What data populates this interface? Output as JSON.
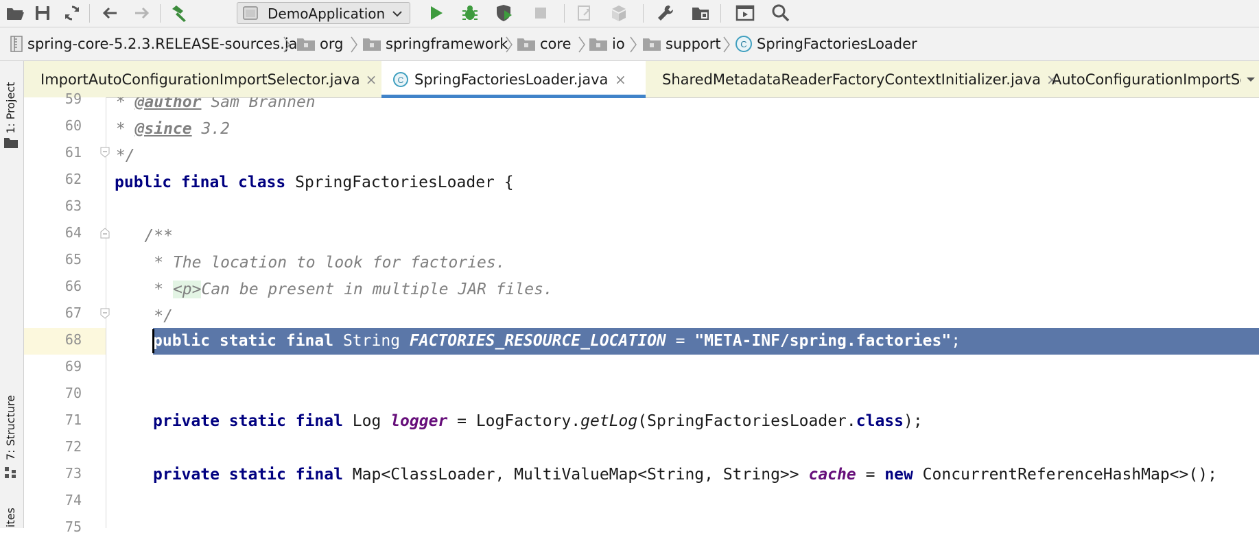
{
  "toolbar": {
    "run_config": "DemoApplication",
    "icons": [
      "open-icon",
      "save-icon",
      "sync-icon",
      "back-icon",
      "forward-icon",
      "build-hammer-icon",
      "run-icon",
      "debug-icon",
      "coverage-icon",
      "stop-icon",
      "update-icon",
      "deploy-icon",
      "settings-wrench-icon",
      "project-structure-icon",
      "run-anything-icon",
      "search-icon"
    ]
  },
  "breadcrumb": {
    "items": [
      {
        "label": "spring-core-5.2.3.RELEASE-sources.jar",
        "icon": "jar-icon"
      },
      {
        "label": "org",
        "icon": "package-folder-icon"
      },
      {
        "label": "springframework",
        "icon": "package-folder-icon"
      },
      {
        "label": "core",
        "icon": "package-folder-icon"
      },
      {
        "label": "io",
        "icon": "package-folder-icon"
      },
      {
        "label": "support",
        "icon": "package-folder-icon"
      },
      {
        "label": "SpringFactoriesLoader",
        "icon": "class-icon"
      }
    ]
  },
  "left_strip": {
    "project_tab": "1: Project",
    "structure_tab": "7: Structure",
    "favorites_tab": "ites"
  },
  "tabs": [
    {
      "label": "ImportAutoConfigurationImportSelector.java",
      "close": "×",
      "active": false
    },
    {
      "label": "SpringFactoriesLoader.java",
      "close": "×",
      "active": true
    },
    {
      "label": "SharedMetadataReaderFactoryContextInitializer.java",
      "close": "×",
      "active": false
    },
    {
      "label": "AutoConfigurationImportSe",
      "close": "",
      "active": false
    }
  ],
  "editor": {
    "line_numbers": [
      "59",
      "60",
      "61",
      "62",
      "63",
      "64",
      "65",
      "66",
      "67",
      "68",
      "69",
      "70",
      "71",
      "72",
      "73",
      "74",
      "75"
    ],
    "highlighted_line": "68",
    "code": {
      "l59_a": " * ",
      "l59_tag": "@author",
      "l59_b": " Sam Brannen",
      "l60_a": " * ",
      "l60_tag": "@since",
      "l60_b": " 3.2",
      "l61": " */",
      "l62_kw": "public final class",
      "l62_rest": " SpringFactoriesLoader {",
      "l64": "    /**",
      "l65": "     * The location to look for factories.",
      "l66_a": "     * ",
      "l66_html": "<p>",
      "l66_b": "Can be present in multiple JAR files.",
      "l67": "     */",
      "l68_kw": "public static final",
      "l68_type": " String ",
      "l68_field": "FACTORIES_RESOURCE_LOCATION",
      "l68_eq": " = ",
      "l68_str": "\"META-INF/spring.factories\"",
      "l68_end": ";",
      "l71_kw": "private static final",
      "l71_type": " Log ",
      "l71_field": "logger",
      "l71_eq": " = LogFactory.",
      "l71_method": "getLog",
      "l71_arg": "(SpringFactoriesLoader.",
      "l71_kw2": "class",
      "l71_end": ");",
      "l73_kw": "private static final",
      "l73_type": " Map<ClassLoader, MultiValueMap<String, String>> ",
      "l73_field": "cache",
      "l73_eq": " = ",
      "l73_kw2": "new",
      "l73_end": " ConcurrentReferenceHashMap<>();"
    }
  },
  "colors": {
    "selection": "#5b77a8",
    "keyword": "#000080",
    "field": "#660e7a",
    "comment": "#808080",
    "tab_bar": "#f5f5dc",
    "active_tab_underline": "#4083c9"
  }
}
